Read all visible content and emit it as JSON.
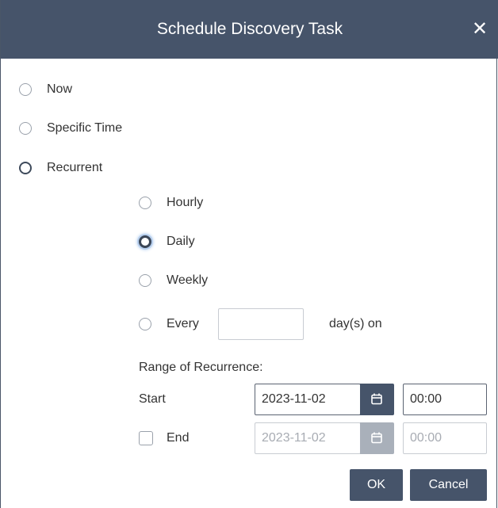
{
  "dialog": {
    "title": "Schedule Discovery Task",
    "close_glyph": "✕"
  },
  "schedule_options": {
    "now": "Now",
    "specific_time": "Specific Time",
    "recurrent": "Recurrent"
  },
  "recurrence_options": {
    "hourly": "Hourly",
    "daily": "Daily",
    "weekly": "Weekly",
    "every": "Every",
    "every_days_value": "",
    "days_on": "day(s) on"
  },
  "range": {
    "heading": "Range of Recurrence:",
    "start_label": "Start",
    "start_date": "2023-11-02",
    "start_time": "00:00",
    "end_label": "End",
    "end_date": "2023-11-02",
    "end_time": "00:00"
  },
  "footer": {
    "ok": "OK",
    "cancel": "Cancel"
  },
  "colors": {
    "titlebar": "#46546a",
    "button": "#46546a",
    "disabled": "#a9b0ba",
    "focus_ring": "#b7cfee"
  },
  "icons": {
    "close": "close-icon",
    "calendar": "calendar-icon"
  }
}
